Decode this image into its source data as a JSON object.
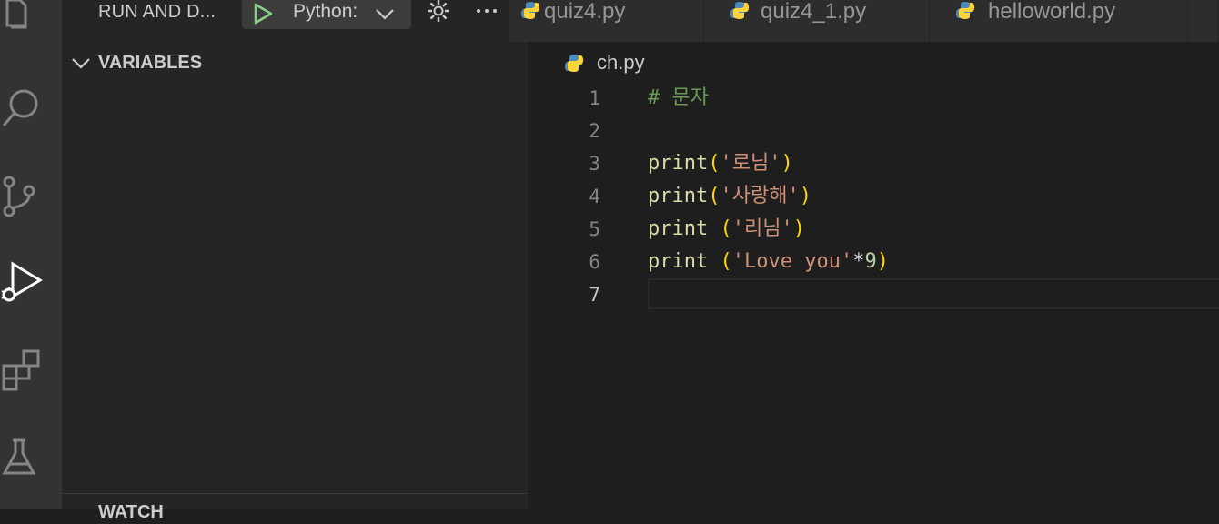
{
  "activity_bar": {
    "icons": [
      "files-icon",
      "search-icon",
      "source-control-icon",
      "run-debug-icon",
      "extensions-icon",
      "testing-icon"
    ],
    "active": "run-debug-icon"
  },
  "debug_panel": {
    "title": "RUN AND D...",
    "launch_config": "Python:",
    "variables_title": "VARIABLES",
    "watch_title": "WATCH"
  },
  "tabs": [
    {
      "label": "quiz4.py"
    },
    {
      "label": "quiz4_1.py"
    },
    {
      "label": "helloworld.py"
    }
  ],
  "breadcrumb": {
    "file": "ch.py"
  },
  "editor": {
    "current_line": 7,
    "lines": [
      {
        "number": "1",
        "tokens": [
          {
            "t": "# 문자",
            "c": "comment"
          }
        ]
      },
      {
        "number": "2",
        "tokens": []
      },
      {
        "number": "3",
        "tokens": [
          {
            "t": "print",
            "c": "func"
          },
          {
            "t": "(",
            "c": "paren"
          },
          {
            "t": "'로님'",
            "c": "string"
          },
          {
            "t": ")",
            "c": "paren"
          }
        ]
      },
      {
        "number": "4",
        "tokens": [
          {
            "t": "print",
            "c": "func"
          },
          {
            "t": "(",
            "c": "paren"
          },
          {
            "t": "'사랑해'",
            "c": "string"
          },
          {
            "t": ")",
            "c": "paren"
          }
        ]
      },
      {
        "number": "5",
        "tokens": [
          {
            "t": "print",
            "c": "func"
          },
          {
            "t": " ",
            "c": "op"
          },
          {
            "t": "(",
            "c": "paren"
          },
          {
            "t": "'리님'",
            "c": "string"
          },
          {
            "t": ")",
            "c": "paren"
          }
        ]
      },
      {
        "number": "6",
        "tokens": [
          {
            "t": "print",
            "c": "func"
          },
          {
            "t": " ",
            "c": "op"
          },
          {
            "t": "(",
            "c": "paren"
          },
          {
            "t": "'Love you'",
            "c": "string"
          },
          {
            "t": "*",
            "c": "op"
          },
          {
            "t": "9",
            "c": "num"
          },
          {
            "t": ")",
            "c": "paren"
          }
        ]
      },
      {
        "number": "7",
        "tokens": []
      }
    ]
  },
  "colors": {
    "accent_play": "#89d185",
    "python_blue": "#4b8bbe",
    "python_yellow": "#ffd43b"
  }
}
